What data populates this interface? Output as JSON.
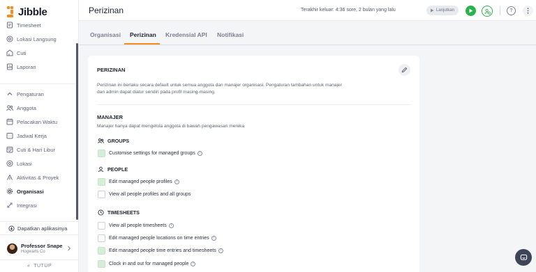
{
  "app": {
    "name": "Jibble"
  },
  "sidebar": {
    "top_items": [
      {
        "label": "Timesheet",
        "icon": "timesheet-icon"
      },
      {
        "label": "Lokasi Langsung",
        "icon": "location-pin-icon"
      },
      {
        "label": "Cuti",
        "icon": "leave-icon"
      },
      {
        "label": "Laporan",
        "icon": "report-icon"
      }
    ],
    "settings_header": "Pengaturan",
    "settings_items": [
      {
        "label": "Anggota",
        "icon": "members-icon"
      },
      {
        "label": "Pelacakan Waktu",
        "icon": "time-tracking-icon"
      },
      {
        "label": "Jadwal Kerja",
        "icon": "work-schedule-icon"
      },
      {
        "label": "Cuti & Hari Libur",
        "icon": "holiday-icon"
      },
      {
        "label": "Lokasi",
        "icon": "location-icon"
      },
      {
        "label": "Aktivitas & Proyek",
        "icon": "activity-icon"
      },
      {
        "label": "Organisasi",
        "icon": "gear-icon",
        "active": true
      },
      {
        "label": "Integrasi",
        "icon": "integration-icon"
      }
    ],
    "get_app": "Dapatkan aplikasinya",
    "profile": {
      "name": "Professor Snape",
      "org": "Hogwarts Co"
    },
    "collapse": "TUTUP"
  },
  "header": {
    "title": "Perizinan",
    "last_out": "Terakhir keluar: 4:36 sore, 2 bulan yang lalu",
    "resume": "Lanjutkan"
  },
  "tabs": [
    {
      "label": "Organisasi",
      "active": false
    },
    {
      "label": "Perizinan",
      "active": true
    },
    {
      "label": "Kredensial API",
      "active": false
    },
    {
      "label": "Notifikasi",
      "active": false
    }
  ],
  "card": {
    "title": "PERIZINAN",
    "description": "Perizinan ini berlaku secara default untuk semua anggota dan manajer organisasi. Pengaturan tambahan untuk manajer dan admin dapat diatur sendiri pada profil masing-masing.",
    "manager_title": "MANAJER",
    "manager_desc": "Manajer hanya dapat mengelola anggota di bawah pengawasan mereka",
    "groups": [
      {
        "title": "GROUPS",
        "icon": "groups-icon",
        "items": [
          {
            "label": "Customise settings for managed groups",
            "checked": true,
            "info": true
          }
        ]
      },
      {
        "title": "PEOPLE",
        "icon": "person-icon",
        "items": [
          {
            "label": "Edit managed people profiles",
            "checked": true,
            "info": true
          },
          {
            "label": "View all people profiles and all groups",
            "checked": false,
            "info": false
          }
        ]
      },
      {
        "title": "TIMESHEETS",
        "icon": "clock-icon",
        "items": [
          {
            "label": "View all people timesheets",
            "checked": false,
            "info": true
          },
          {
            "label": "Edit managed people locations on time entries",
            "checked": false,
            "info": true
          },
          {
            "label": "Edit managed people time entries and timesheets",
            "checked": true,
            "info": true
          },
          {
            "label": "Clock in and out for managed people",
            "checked": true,
            "info": true
          }
        ]
      }
    ]
  }
}
